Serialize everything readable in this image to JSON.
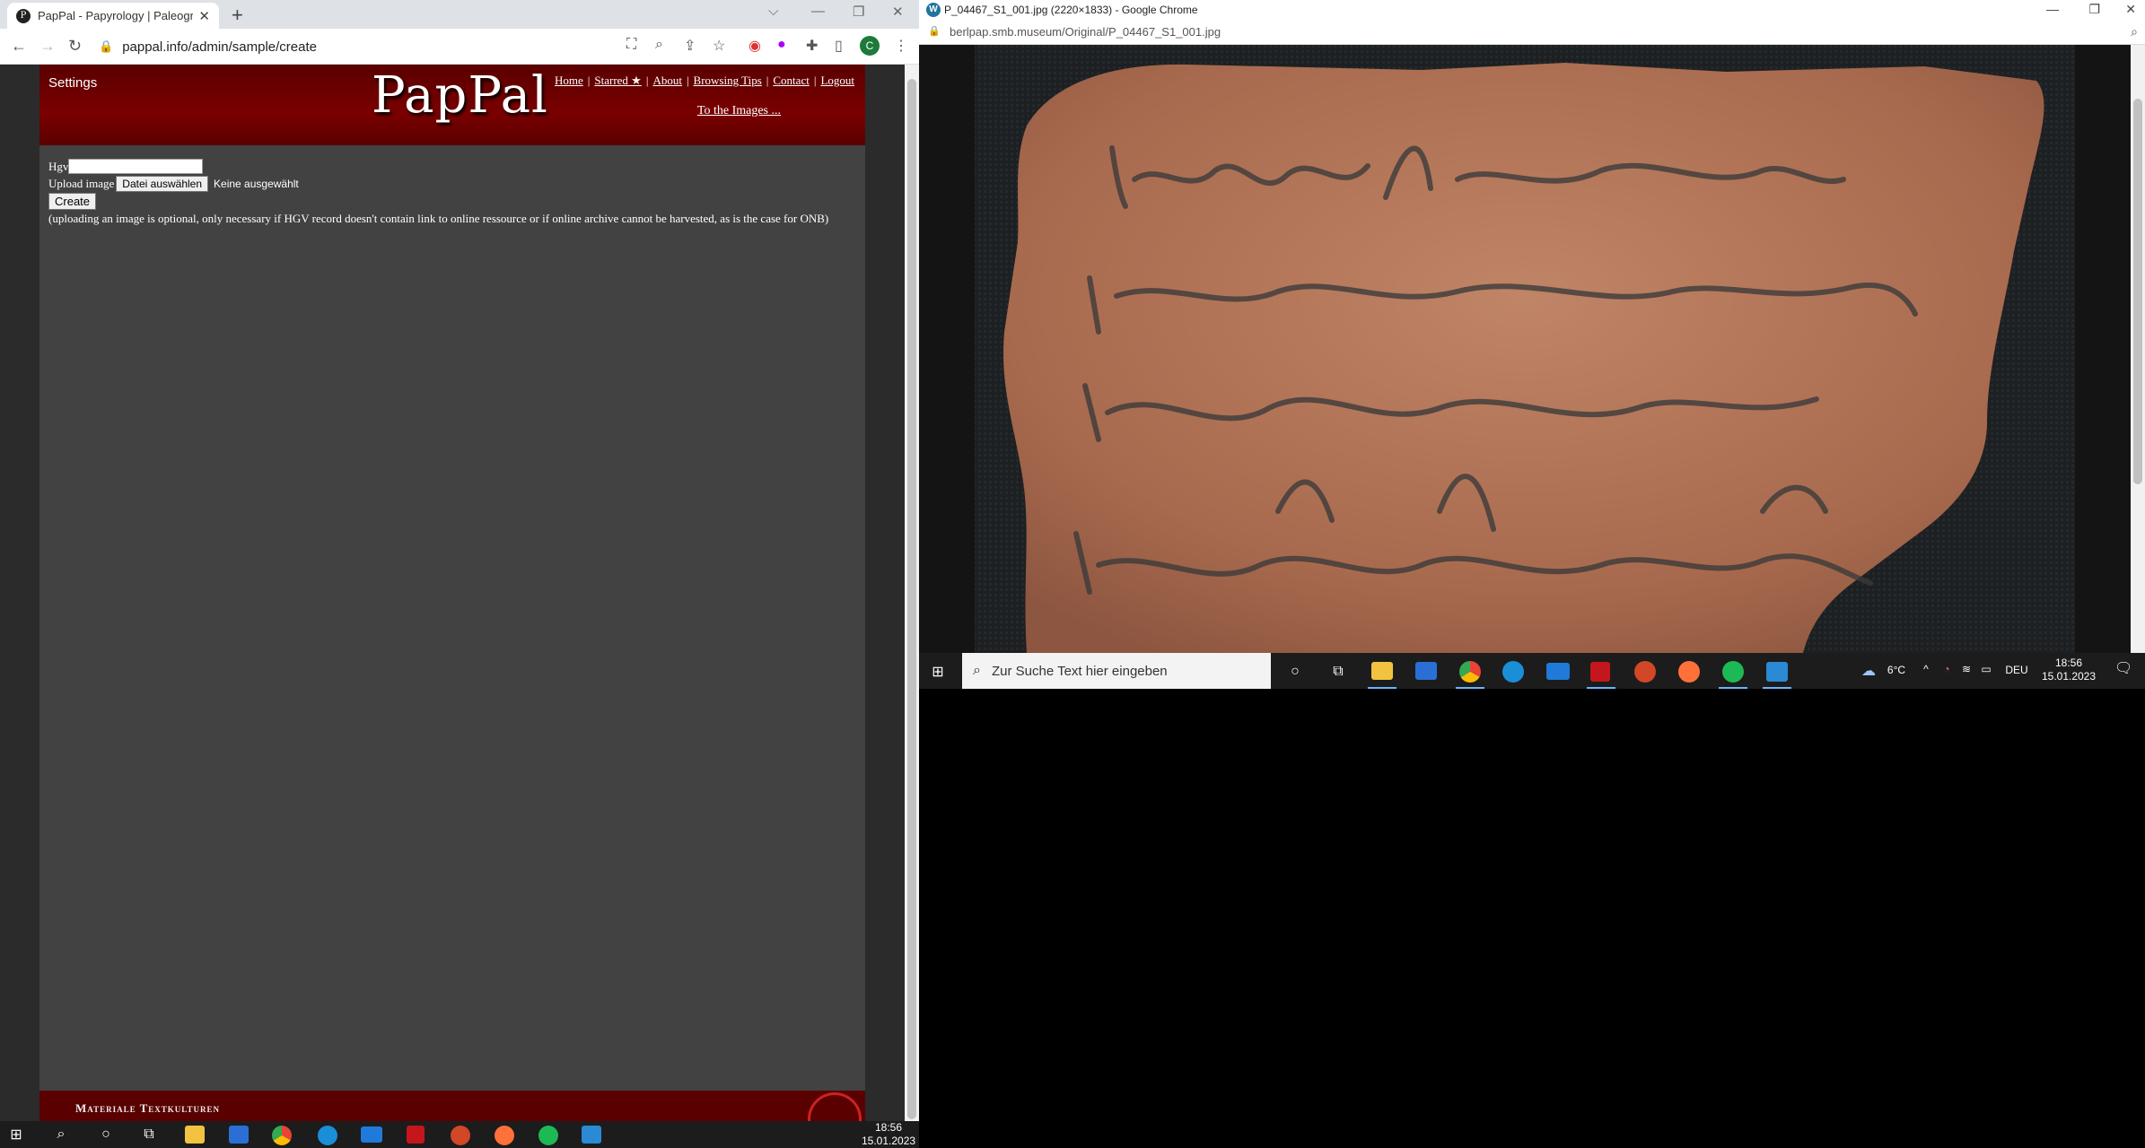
{
  "left_browser": {
    "tab_title": "PapPal - Papyrology | Paleograph",
    "favicon_letter": "P",
    "url": "pappal.info/admin/sample/create"
  },
  "site": {
    "settings_label": "Settings",
    "logo": "PapPal",
    "nav": {
      "home": "Home",
      "starred": "Starred ★",
      "about": "About",
      "browsing_tips": "Browsing Tips",
      "contact": "Contact",
      "logout": "Logout"
    },
    "to_images": "To the Images ...",
    "form": {
      "hgv_label": "Hgv",
      "hgv_value": "",
      "upload_label": "Upload image",
      "file_button": "Datei auswählen",
      "file_status": "Keine ausgewählt",
      "create_button": "Create",
      "note": "(uploading an image is optional, only necessary if HGV record doesn't contain link to online ressource or if online archive cannot be harvested, as is the case for ONB)"
    },
    "footer_text": "Materiale Textkulturen"
  },
  "right_browser": {
    "window_title": "P_04467_S1_001.jpg (2220×1833) - Google Chrome",
    "url": "berlpap.smb.museum/Original/P_04467_S1_001.jpg"
  },
  "taskbar_right": {
    "search_placeholder": "Zur Suche Text hier eingeben",
    "weather": "6°C",
    "language": "DEU",
    "time": "18:56",
    "date": "15.01.2023"
  },
  "taskbar_left": {
    "time": "18:56",
    "date": "15.01.2023"
  }
}
